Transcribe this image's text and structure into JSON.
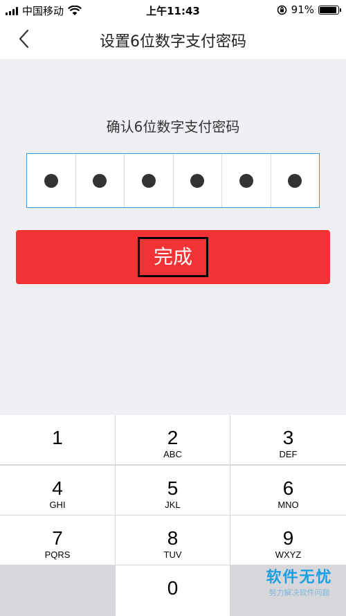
{
  "status": {
    "carrier": "中国移动",
    "time": "上午11:43",
    "battery": "91%",
    "battery_level": 0.91
  },
  "nav": {
    "title": "设置6位数字支付密码"
  },
  "prompt": "确认6位数字支付密码",
  "pin": {
    "filled": 6,
    "total": 6
  },
  "done_button": {
    "label": "完成",
    "color": "#f23335"
  },
  "keypad": {
    "keys": [
      {
        "num": "1",
        "letters": ""
      },
      {
        "num": "2",
        "letters": "ABC"
      },
      {
        "num": "3",
        "letters": "DEF"
      },
      {
        "num": "4",
        "letters": "GHI"
      },
      {
        "num": "5",
        "letters": "JKL"
      },
      {
        "num": "6",
        "letters": "MNO"
      },
      {
        "num": "7",
        "letters": "PQRS"
      },
      {
        "num": "8",
        "letters": "TUV"
      },
      {
        "num": "9",
        "letters": "WXYZ"
      },
      {
        "num": "0",
        "letters": ""
      }
    ]
  },
  "watermark": {
    "main": "软件无忧",
    "sub": "努力解决软件问题"
  },
  "icons": {
    "back": "chevron-left-icon",
    "wifi": "wifi-icon",
    "lock": "orientation-lock-icon",
    "battery": "battery-icon"
  }
}
